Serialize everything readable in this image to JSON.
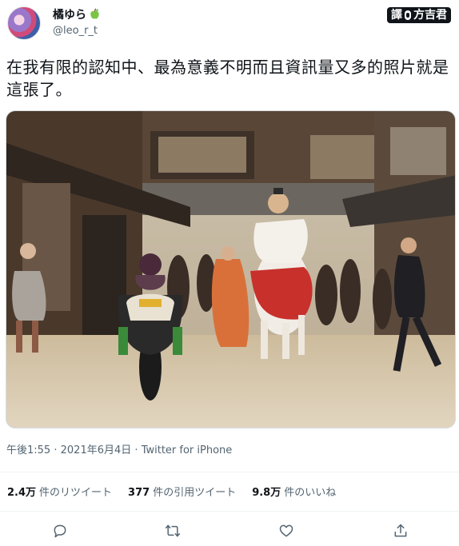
{
  "author": {
    "display_name": "橘ゆら",
    "handle": "@leo_r_t",
    "name_icon": "green-apple-emoji"
  },
  "watermark": {
    "left": "譯",
    "right": "方吉君"
  },
  "tweet": {
    "text": "在我有限的認知中、最為意義不明而且資訊量又多的照片就是這張了。"
  },
  "meta": {
    "time": "午後1:55",
    "date": "2021年6月4日",
    "source": "Twitter for iPhone",
    "separator": "·"
  },
  "stats": [
    {
      "count": "2.4万",
      "label": "件のリツイート"
    },
    {
      "count": "377",
      "label": "件の引用ツイート"
    },
    {
      "count": "9.8万",
      "label": "件のいいね"
    }
  ],
  "actions": [
    "reply-icon",
    "retweet-icon",
    "like-icon",
    "share-icon"
  ],
  "colors": {
    "text": "#0f1419",
    "secondary": "#536471",
    "divider": "#eff3f4"
  }
}
